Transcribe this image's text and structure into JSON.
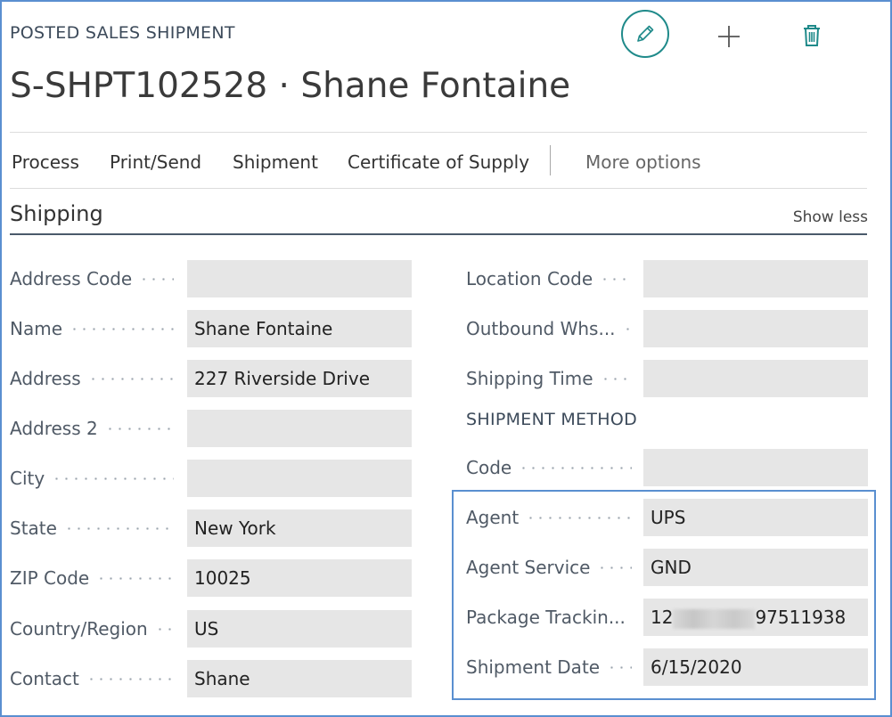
{
  "header": {
    "caption": "POSTED SALES SHIPMENT",
    "title": "S-SHPT102528 · Shane Fontaine",
    "icons": [
      "pencil-icon",
      "plus-icon",
      "trash-icon"
    ],
    "accent_color": "#1f8a8a"
  },
  "actions": {
    "process": "Process",
    "print_send": "Print/Send",
    "shipment": "Shipment",
    "certificate": "Certificate of Supply",
    "more": "More options"
  },
  "section": {
    "title": "Shipping",
    "toggle": "Show less"
  },
  "left_fields": [
    {
      "label": "Address Code",
      "value": ""
    },
    {
      "label": "Name",
      "value": "Shane Fontaine"
    },
    {
      "label": "Address",
      "value": "227 Riverside Drive"
    },
    {
      "label": "Address 2",
      "value": ""
    },
    {
      "label": "City",
      "value": ""
    },
    {
      "label": "State",
      "value": "New York"
    },
    {
      "label": "ZIP Code",
      "value": "10025"
    },
    {
      "label": "Country/Region",
      "value": "US"
    },
    {
      "label": "Contact",
      "value": "Shane"
    }
  ],
  "right_fields": [
    {
      "label": "Location Code",
      "value": ""
    },
    {
      "label": "Outbound Whs...",
      "value": ""
    },
    {
      "label": "Shipping Time",
      "value": ""
    }
  ],
  "shipment_method": {
    "heading": "SHIPMENT METHOD",
    "fields": [
      {
        "label": "Code",
        "value": ""
      },
      {
        "label": "Agent",
        "value": "UPS"
      },
      {
        "label": "Agent Service",
        "value": "GND"
      },
      {
        "label": "Package Trackin...",
        "value_prefix": "12",
        "value_suffix": "97511938"
      },
      {
        "label": "Shipment Date",
        "value": "6/15/2020"
      }
    ]
  }
}
